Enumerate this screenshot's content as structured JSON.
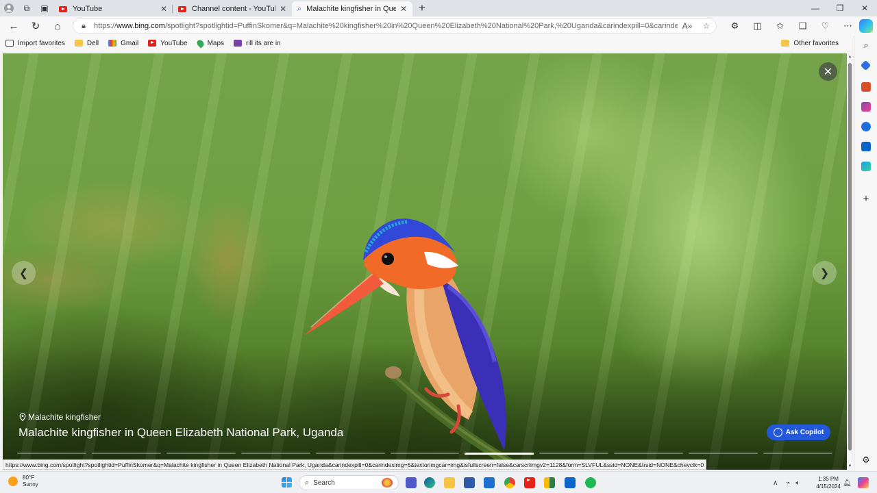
{
  "browser": {
    "tabs": [
      {
        "title": "YouTube",
        "favicon": "youtube-icon"
      },
      {
        "title": "Channel content - YouTube Studio",
        "favicon": "youtube-icon"
      },
      {
        "title": "Malachite kingfisher in Queen Elizabeth National Park, Uganda",
        "favicon": "search-icon",
        "active": true
      }
    ],
    "url_prefix": "https://",
    "url_domain": "www.bing.com",
    "url_rest": "/spotlight?spotlightid=PuffinSkomer&q=Malachite%20kingfisher%20in%20Queen%20Elizabeth%20National%20Park,%20Uganda&carindexpill=0&carindeximg=6...",
    "favorites": [
      {
        "label": "Import favorites",
        "icon": "import-icon"
      },
      {
        "label": "Dell",
        "icon": "folder-icon"
      },
      {
        "label": "Gmail",
        "icon": "gmail-icon"
      },
      {
        "label": "YouTube",
        "icon": "youtube-icon"
      },
      {
        "label": "Maps",
        "icon": "maps-pin-icon"
      },
      {
        "label": "rill its are in",
        "icon": "bookmark-icon"
      }
    ],
    "other_favorites": "Other favorites",
    "status_url": "https://www.bing.com/spotlight?spotlightid=PuffinSkomer&q=Malachite kingfisher in Queen Elizabeth National Park, Uganda&carindexpill=0&carindeximg=6&textorimgcar=img&isfullscreen=false&carscrlimgv2=1128&form=SLVFUL&ssid=NONE&trsid=NONE&chevclk=0"
  },
  "spotlight": {
    "location": "Malachite kingfisher",
    "title": "Malachite kingfisher in Queen Elizabeth National Park, Uganda",
    "ask_copilot": "Ask Copilot",
    "slide_count": 11,
    "active_slide": 6
  },
  "taskbar": {
    "temperature": "80°F",
    "condition": "Sunny",
    "search_placeholder": "Search",
    "time": "1:35 PM",
    "date": "4/15/2024"
  },
  "colors": {
    "accent": "#2359d9",
    "youtube_red": "#e62117"
  }
}
